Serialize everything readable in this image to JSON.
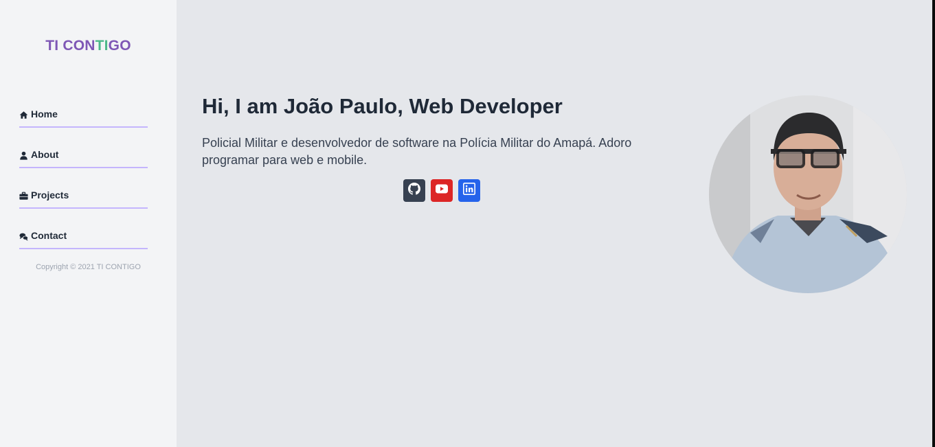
{
  "colors": {
    "purple": "#7e57b5",
    "green": "#4cb88a",
    "github": "#374151",
    "youtube": "#dc2626",
    "linkedin": "#2563eb"
  },
  "sidebar": {
    "logo": {
      "part1": "TI CON",
      "part2": "TI",
      "part3": "GO"
    },
    "items": [
      {
        "label": "Home",
        "icon": "home-icon"
      },
      {
        "label": "About",
        "icon": "user-icon"
      },
      {
        "label": "Projects",
        "icon": "briefcase-icon"
      },
      {
        "label": "Contact",
        "icon": "chat-icon"
      }
    ],
    "copyright": "Copyright © 2021 TI CONTIGO"
  },
  "main": {
    "headline": "Hi, I am João Paulo, Web Developer",
    "bio": "Policial Militar e desenvolvedor de software na Polícia Militar do Amapá. Adoro programar para web e mobile.",
    "socials": [
      {
        "icon": "github-icon"
      },
      {
        "icon": "youtube-icon"
      },
      {
        "icon": "linkedin-icon"
      }
    ],
    "avatar_icon": "profile-photo"
  }
}
